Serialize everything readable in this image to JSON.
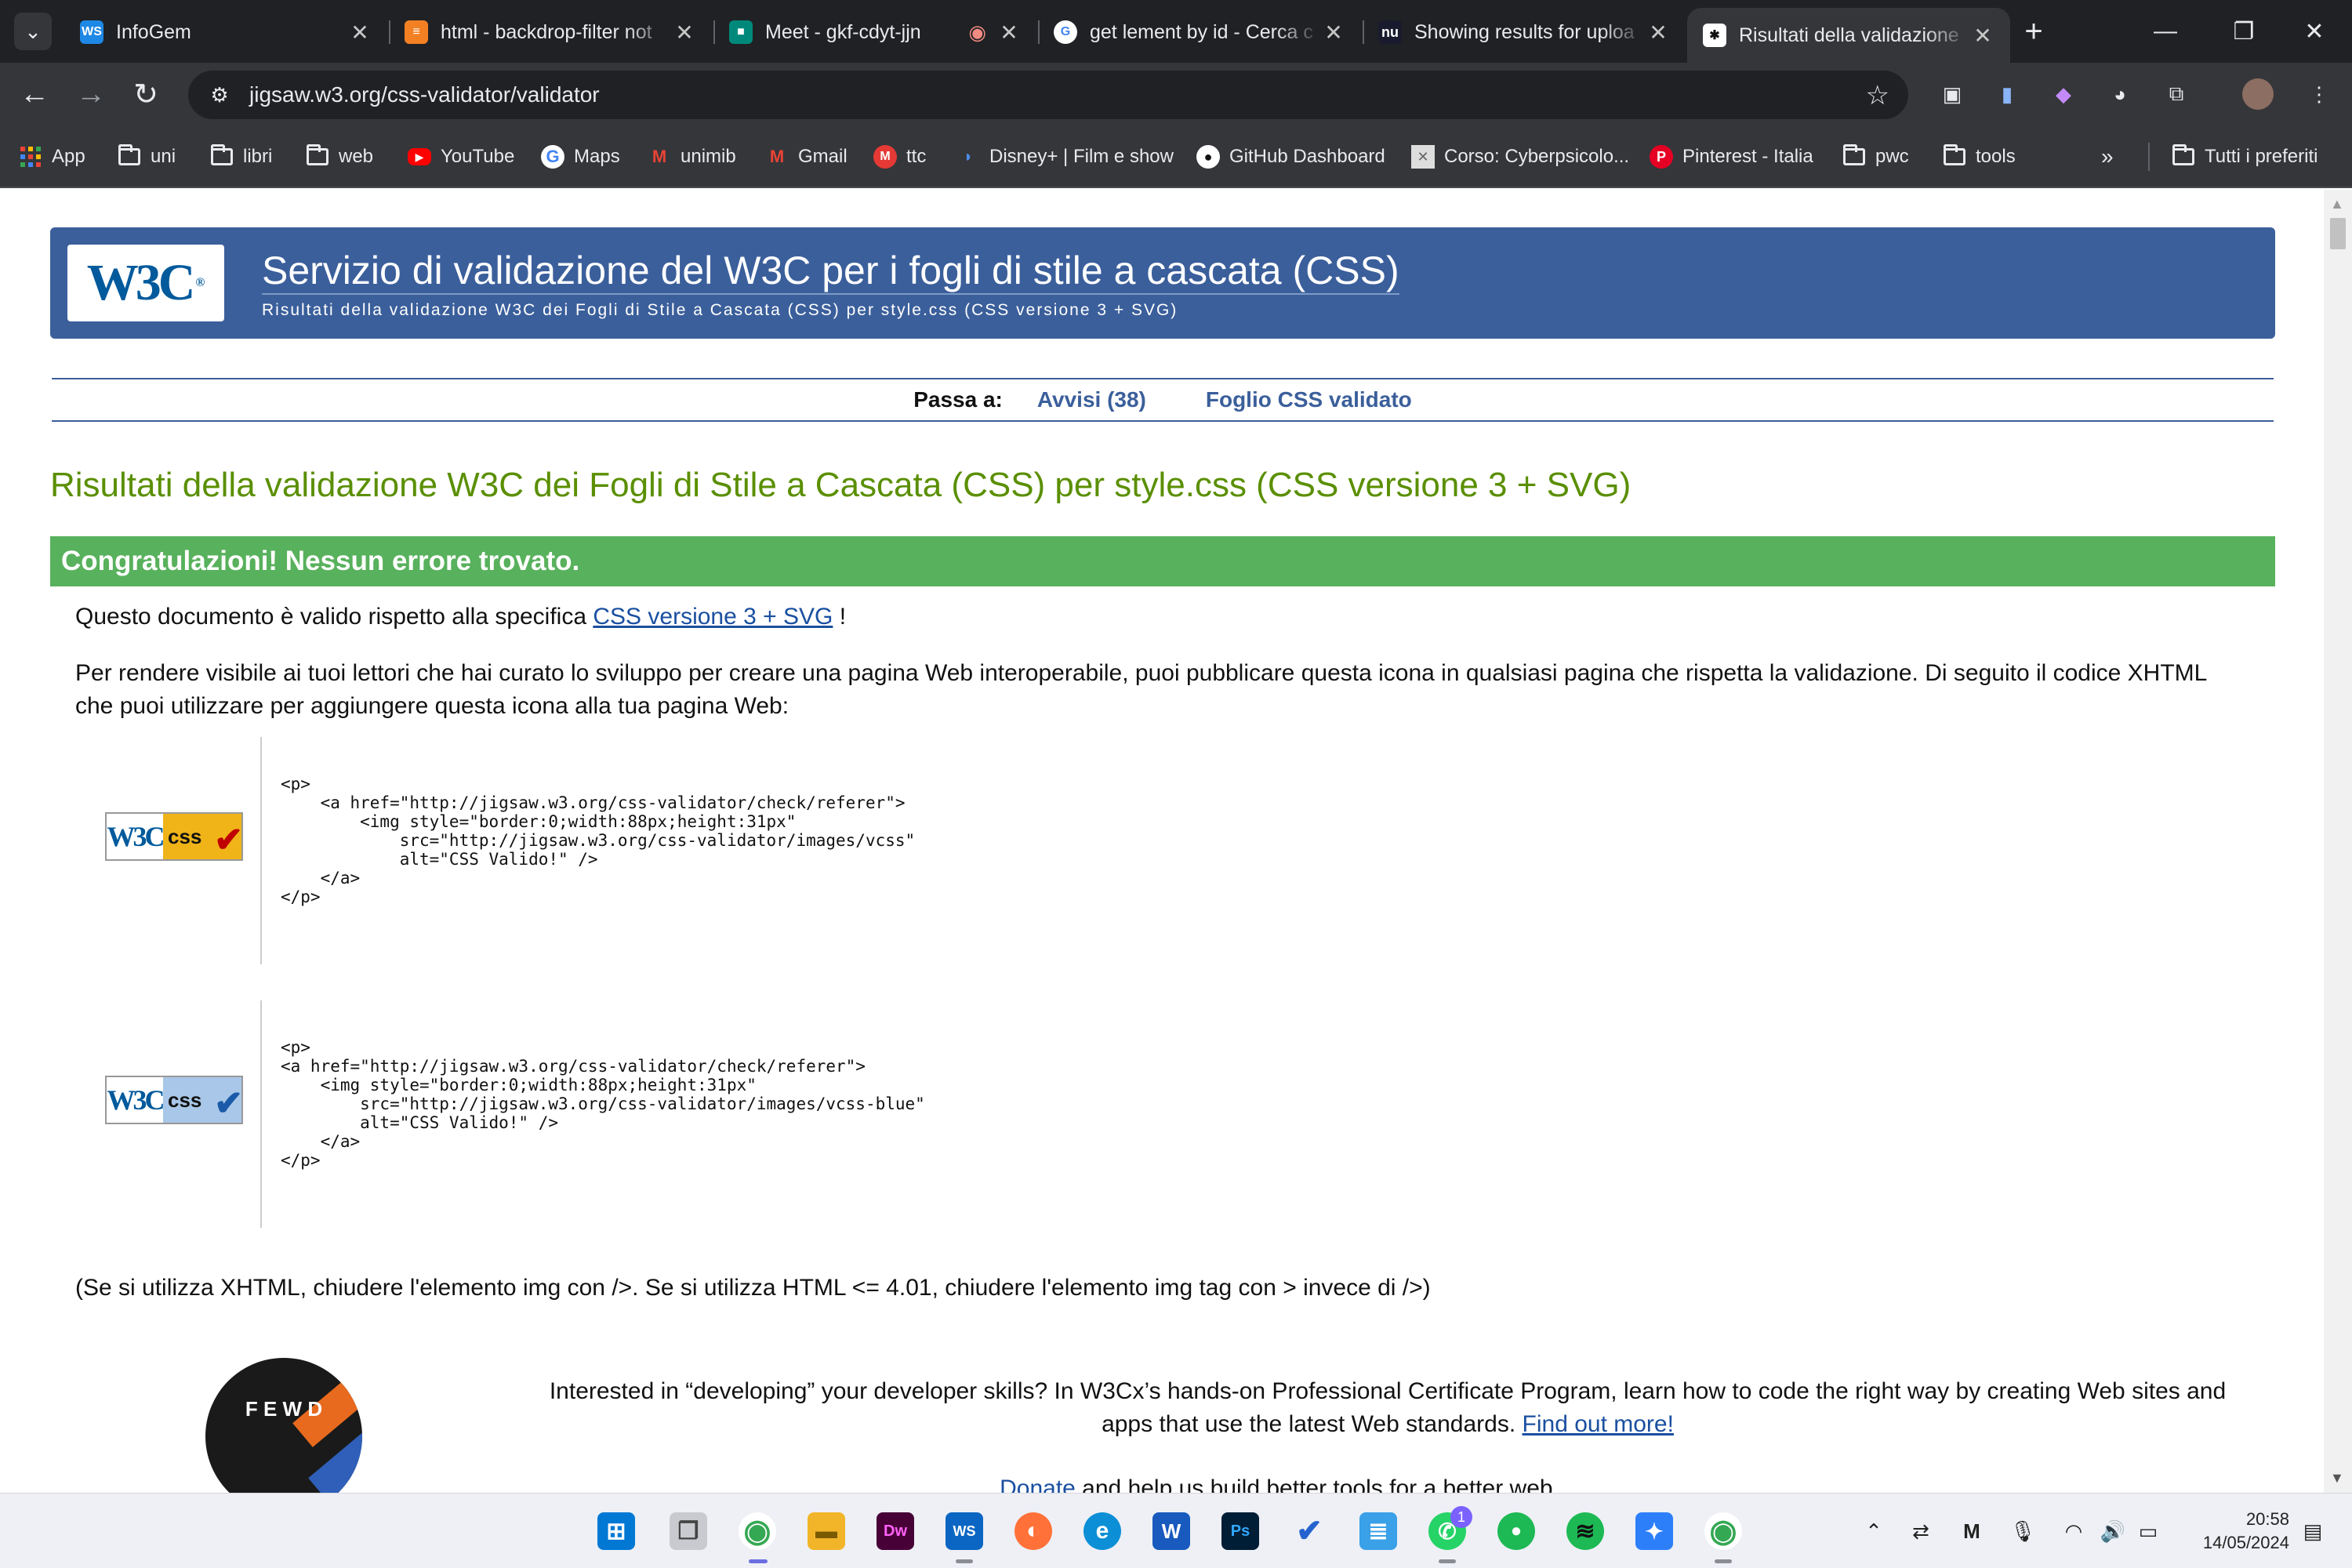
{
  "browser": {
    "tabs": [
      {
        "title": "InfoGem",
        "icon": "webstorm-icon",
        "color": "#1e88e5",
        "glyph": "WS"
      },
      {
        "title": "html - backdrop-filter not",
        "icon": "stackoverflow-icon",
        "color": "#f48024",
        "glyph": "≡"
      },
      {
        "title": "Meet - gkf-cdyt-jjn",
        "icon": "google-meet-icon",
        "color": "#00897b",
        "glyph": "■"
      },
      {
        "title": "get lement by id - Cerca c",
        "icon": "google-icon",
        "color": "#ffffff",
        "glyph": "G"
      },
      {
        "title": "Showing results for uploa",
        "icon": "nu-icon",
        "color": "#1a1a2e",
        "glyph": "nu"
      },
      {
        "title": "Risultati della validazione",
        "icon": "w3c-icon",
        "color": "#ffffff",
        "glyph": "✱"
      }
    ],
    "url": "jigsaw.w3.org/css-validator/validator",
    "bookmarks": [
      {
        "label": "App",
        "icon": "apps-icon"
      },
      {
        "label": "uni",
        "icon": "folder-icon"
      },
      {
        "label": "libri",
        "icon": "folder-icon"
      },
      {
        "label": "web",
        "icon": "folder-icon"
      },
      {
        "label": "YouTube",
        "icon": "youtube-icon"
      },
      {
        "label": "Maps",
        "icon": "google-icon"
      },
      {
        "label": "unimib",
        "icon": "gmail-icon"
      },
      {
        "label": "Gmail",
        "icon": "gmail-icon"
      },
      {
        "label": "ttc",
        "icon": "ttc-icon"
      },
      {
        "label": "Disney+ | Film e show",
        "icon": "disney-icon"
      },
      {
        "label": "GitHub Dashboard",
        "icon": "github-icon"
      },
      {
        "label": "Corso: Cyberpsicolo...",
        "icon": "course-icon"
      },
      {
        "label": "Pinterest - Italia",
        "icon": "pinterest-icon"
      },
      {
        "label": "pwc",
        "icon": "folder-icon"
      },
      {
        "label": "tools",
        "icon": "folder-icon"
      }
    ],
    "all_bookmarks": "Tutti i preferiti"
  },
  "page": {
    "banner_title": "Servizio di validazione del W3C per i fogli di stile a cascata (CSS)",
    "banner_subtitle": "Risultati della validazione W3C dei Fogli di Stile a Cascata (CSS) per style.css (CSS versione 3 + SVG)",
    "logo_text": "W3C",
    "jump_label": "Passa a:",
    "jump_warnings": "Avvisi (38)",
    "jump_validated": "Foglio CSS validato",
    "results_title": "Risultati della validazione W3C dei Fogli di Stile a Cascata (CSS) per style.css (CSS versione 3 + SVG)",
    "congrats": "Congratulazioni! Nessun errore trovato.",
    "valid_prefix": "Questo documento è valido rispetto alla specifica ",
    "valid_link": "CSS versione 3 + SVG",
    "valid_suffix": " !",
    "icon_paragraph": "Per rendere visibile ai tuoi lettori che hai curato lo sviluppo per creare una pagina Web interoperabile, puoi pubblicare questa icona in qualsiasi pagina che rispetta la validazione. Di seguito il codice XHTML che puoi utilizzare per aggiungere questa icona alla tua pagina Web:",
    "badge_w3c": "W3C",
    "badge_css": "css",
    "code_gold": "<p>\n    <a href=\"http://jigsaw.w3.org/css-validator/check/referer\">\n        <img style=\"border:0;width:88px;height:31px\"\n            src=\"http://jigsaw.w3.org/css-validator/images/vcss\"\n            alt=\"CSS Valido!\" />\n    </a>\n</p>",
    "code_blue": "<p>\n<a href=\"http://jigsaw.w3.org/css-validator/check/referer\">\n    <img style=\"border:0;width:88px;height:31px\"\n        src=\"http://jigsaw.w3.org/css-validator/images/vcss-blue\"\n        alt=\"CSS Valido!\" />\n    </a>\n</p>",
    "xhtml_note": "(Se si utilizza XHTML, chiudere l'elemento img con />. Se si utilizza HTML <= 4.01, chiudere l'elemento img tag con > invece di />)",
    "promo_text": "Interested in “developing” your developer skills? In W3Cx’s hands-on Professional Certificate Program, learn how to code the right way by creating Web sites and apps that use the latest Web standards. ",
    "promo_link": "Find out more!",
    "donate_link": "Donate",
    "donate_text": " and help us build better tools for a better web.",
    "promo_badge_letters": "F E W D"
  },
  "taskbar": {
    "time": "20:58",
    "date": "14/05/2024",
    "whatsapp_badge": "1",
    "apps": [
      {
        "name": "windows-start-icon",
        "color": "#0078d4",
        "glyph": "⊞"
      },
      {
        "name": "task-view-icon",
        "color": "#8a8d93",
        "glyph": "❐"
      },
      {
        "name": "chrome-icon",
        "color": "#34a853",
        "glyph": "◉"
      },
      {
        "name": "file-explorer-icon",
        "color": "#f2b52a",
        "glyph": "▬"
      },
      {
        "name": "dreamweaver-icon",
        "color": "#470137",
        "glyph": "Dw"
      },
      {
        "name": "webstorm-icon",
        "color": "#0a66c2",
        "glyph": "WS"
      },
      {
        "name": "firefox-icon",
        "color": "#ff7139",
        "glyph": "◐"
      },
      {
        "name": "edge-icon",
        "color": "#0c8fd6",
        "glyph": "e"
      },
      {
        "name": "word-icon",
        "color": "#185abd",
        "glyph": "W"
      },
      {
        "name": "photoshop-icon",
        "color": "#001e36",
        "glyph": "Ps"
      },
      {
        "name": "todo-icon",
        "color": "#2564cf",
        "glyph": "✔"
      },
      {
        "name": "notepad-icon",
        "color": "#3aa0e8",
        "glyph": "≣"
      },
      {
        "name": "whatsapp-icon",
        "color": "#25d366",
        "glyph": "✆"
      },
      {
        "name": "green-app-icon",
        "color": "#1db954",
        "glyph": "●"
      },
      {
        "name": "spotify-icon",
        "color": "#1db954",
        "glyph": "≋"
      },
      {
        "name": "blue-app-icon",
        "color": "#2d7ff9",
        "glyph": "✦"
      },
      {
        "name": "chrome-profile-icon",
        "color": "#34a853",
        "glyph": "◉"
      }
    ]
  },
  "colors": {
    "banner": "#3b5f9b",
    "title_green": "#5a8f00",
    "congrats_green": "#58b15c",
    "link_blue": "#1a4fa0"
  }
}
